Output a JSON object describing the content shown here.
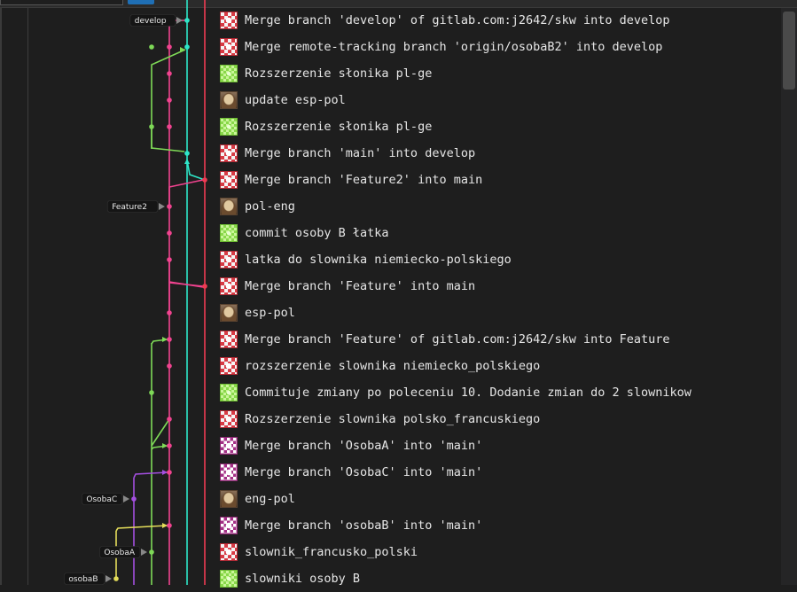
{
  "commits": [
    {
      "message": "Merge branch 'develop' of gitlab.com:j2642/skw into develop",
      "avatar": "red"
    },
    {
      "message": "Merge remote-tracking branch 'origin/osobaB2' into develop",
      "avatar": "red"
    },
    {
      "message": "Rozszerzenie słonika pl-ge",
      "avatar": "green"
    },
    {
      "message": "update esp-pol",
      "avatar": "photo"
    },
    {
      "message": "Rozszerzenie słonika pl-ge",
      "avatar": "green"
    },
    {
      "message": "Merge branch 'main' into develop",
      "avatar": "red"
    },
    {
      "message": "Merge branch 'Feature2' into main",
      "avatar": "red"
    },
    {
      "message": "pol-eng",
      "avatar": "photo"
    },
    {
      "message": "commit osoby B łatka",
      "avatar": "green"
    },
    {
      "message": "latka do slownika niemiecko-polskiego",
      "avatar": "red"
    },
    {
      "message": "Merge branch 'Feature' into main",
      "avatar": "red"
    },
    {
      "message": "esp-pol",
      "avatar": "photo"
    },
    {
      "message": "Merge branch 'Feature' of gitlab.com:j2642/skw into Feature",
      "avatar": "red"
    },
    {
      "message": "rozszerzenie slownika niemiecko_polskiego",
      "avatar": "red"
    },
    {
      "message": "Commituje zmiany po poleceniu 10. Dodanie zmian do 2 slownikow",
      "avatar": "green"
    },
    {
      "message": "Rozszerzenie slownika polsko_francuskiego",
      "avatar": "red"
    },
    {
      "message": "Merge branch 'OsobaA' into 'main'",
      "avatar": "purple"
    },
    {
      "message": "Merge branch 'OsobaC' into 'main'",
      "avatar": "purple"
    },
    {
      "message": "eng-pol",
      "avatar": "photo"
    },
    {
      "message": "Merge branch 'osobaB' into 'main'",
      "avatar": "purple"
    },
    {
      "message": "slownik_francusko_polski",
      "avatar": "red"
    },
    {
      "message": "slowniki osoby B",
      "avatar": "green"
    }
  ],
  "branch_labels": [
    {
      "name": "develop",
      "row": 0
    },
    {
      "name": "Feature2",
      "row": 7
    },
    {
      "name": "OsobaC",
      "row": 18
    },
    {
      "name": "OsobaA",
      "row": 20
    },
    {
      "name": "osobaB",
      "row": 21
    }
  ],
  "colors": {
    "lane_cyan": "#2ee6c8",
    "lane_red": "#ee3b52",
    "lane_pink": "#f0438f",
    "lane_green": "#7ed957",
    "lane_purple": "#a44fe0",
    "lane_yellow": "#e4dd5a",
    "background": "#1e1e1e",
    "text": "#e6e6e6"
  }
}
